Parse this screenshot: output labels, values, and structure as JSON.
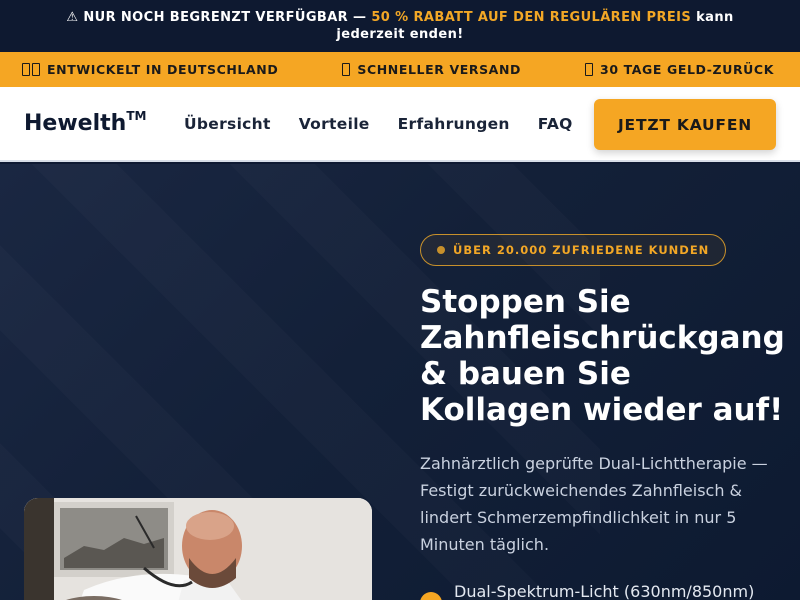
{
  "promo": {
    "warning_symbol": "⚠",
    "text_before": "NUR NOCH BEGRENZT VERFÜGBAR —",
    "highlight": "50 % RABATT AUF DEN REGULÄREN PREIS",
    "text_after": "kann jederzeit enden!",
    "highlight_color": "#f2a726"
  },
  "trust_bar": {
    "color": "#f5a623",
    "items": [
      {
        "label": "ENTWICKELT IN DEUTSCHLAND",
        "icon": "flag-icon"
      },
      {
        "label": "SCHNELLER VERSAND",
        "icon": "truck-icon"
      },
      {
        "label": "30 TAGE GELD-ZURÜCK",
        "icon": "shield-icon"
      }
    ]
  },
  "nav": {
    "logo": "Hewelth",
    "logo_mark": "TM",
    "links": [
      "Übersicht",
      "Vorteile",
      "Erfahrungen",
      "FAQ"
    ],
    "cta": "JETZT KAUFEN"
  },
  "hero": {
    "badge": "ÜBER 20.000 ZUFRIEDENE KUNDEN",
    "headline": "Stoppen Sie Zahnfleischrückgang & bauen Sie Kollagen wieder auf!",
    "subline": "Zahnärztlich geprüfte Dual-Lichttherapie — Festigt zurückweichendes Zahnfleisch & lindert Schmerzempfindlichkeit in nur 5 Minuten täglich.",
    "features": [
      "Dual-Spektrum-Licht (630nm/850nm)"
    ]
  }
}
